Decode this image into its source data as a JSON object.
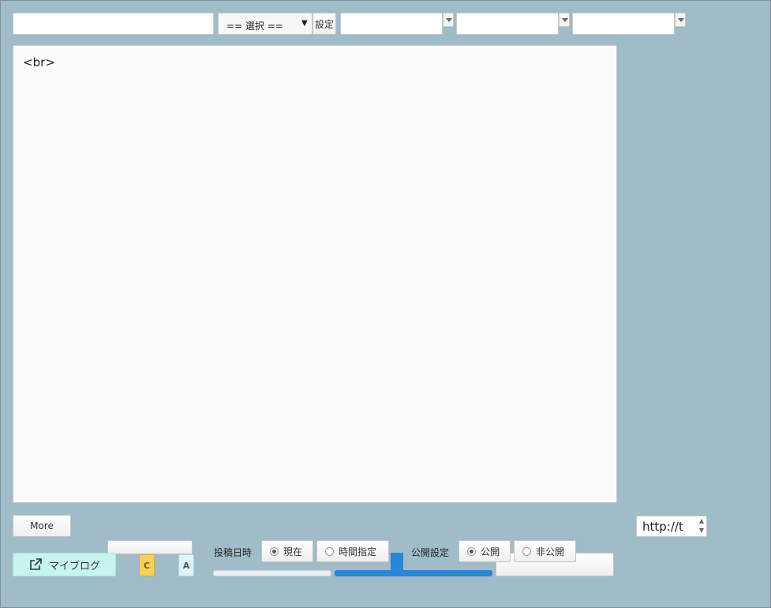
{
  "toolbar": {
    "title_value": "",
    "select_value": "== 選択 ==",
    "set_button": "設定",
    "dropdowns": [
      "",
      "",
      ""
    ]
  },
  "editor": {
    "content": "<br>"
  },
  "more_button": "More",
  "url_field": {
    "value": "http://t"
  },
  "bottom": {
    "myblog_label": "マイブログ",
    "badge_c": "C",
    "badge_a": "A",
    "post_datetime_label": "投稿日時",
    "post_now": "現在",
    "post_scheduled": "時間指定",
    "post_selected": "now",
    "visibility_label": "公開設定",
    "vis_public": "公開",
    "vis_private": "非公開",
    "vis_selected": "public"
  },
  "colors": {
    "background": "#9fbcc8",
    "myblog_bg": "#c6f5ee",
    "badge_c_bg": "#f6cf5c",
    "progress_blue": "#2a86d6"
  }
}
